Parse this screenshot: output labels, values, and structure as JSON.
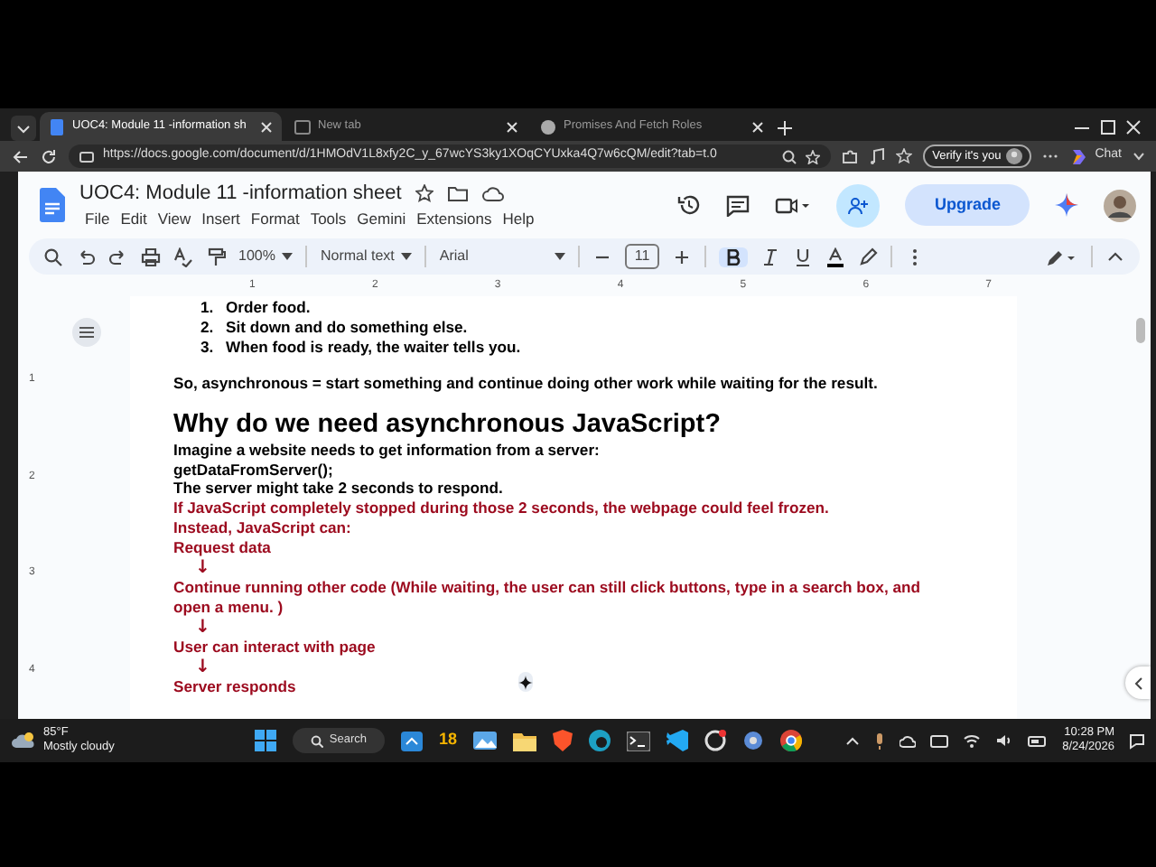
{
  "browser": {
    "tabs": [
      {
        "title": "UOC4: Module 11 -information sh",
        "selected": true
      },
      {
        "title": "New tab",
        "selected": false
      },
      {
        "title": "Promises And Fetch Roles",
        "selected": false
      }
    ],
    "url": "https://docs.google.com/document/d/1HMOdV1L8xfy2C_y_67wcYS3ky1XOqCYUxka4Q7w6cQM/edit?tab=t.0",
    "verify": "Verify it's you",
    "chat": "Chat"
  },
  "docs": {
    "title": "UOC4:  Module 11 -information sheet",
    "menu": [
      "File",
      "Edit",
      "View",
      "Insert",
      "Format",
      "Tools",
      "Gemini",
      "Extensions",
      "Help"
    ],
    "upgrade": "Upgrade",
    "toolbar": {
      "zoom": "100%",
      "style": "Normal text",
      "font": "Arial",
      "size": "11",
      "bold_on": true
    },
    "ruler": [
      "1",
      "2",
      "3",
      "4",
      "5",
      "6",
      "7"
    ],
    "vertical_ruler": [
      "1",
      "2",
      "3",
      "4"
    ]
  },
  "document": [
    {
      "kind": "numbered",
      "number": "1.",
      "text": "Order food.",
      "color": "#000000"
    },
    {
      "kind": "numbered",
      "number": "2.",
      "text": "Sit down and do something else.",
      "color": "#000000"
    },
    {
      "kind": "numbered",
      "number": "3.",
      "text": "When food is ready, the waiter tells you.",
      "color": "#000000"
    },
    {
      "kind": "paragraph",
      "text": "So, asynchronous = start something and continue doing other work while waiting for the result.",
      "color": "#000000"
    },
    {
      "kind": "heading",
      "text": "Why do we need asynchronous JavaScript?",
      "color": "#000000"
    },
    {
      "kind": "line",
      "text": "Imagine a website needs to get information from a server:",
      "color": "#000000"
    },
    {
      "kind": "line",
      "text": "getDataFromServer();",
      "color": "#000000"
    },
    {
      "kind": "line",
      "text": "The server might take 2 seconds to respond.",
      "color": "#000000"
    },
    {
      "kind": "line",
      "text": "If JavaScript completely stopped during those 2 seconds, the webpage could feel frozen.",
      "color": "#9c0a1e"
    },
    {
      "kind": "line",
      "text": "Instead, JavaScript can:",
      "color": "#9c0a1e"
    },
    {
      "kind": "line",
      "text": "Request data",
      "color": "#9c0a1e"
    },
    {
      "kind": "arrow",
      "text": "↓",
      "color": "#9c0a1e"
    },
    {
      "kind": "line",
      "text": "Continue running other code (While waiting, the user can still click buttons, type in a search box, and open a menu. )",
      "color": "#9c0a1e"
    },
    {
      "kind": "arrow",
      "text": "↓",
      "color": "#9c0a1e"
    },
    {
      "kind": "line",
      "text": "User can interact with page",
      "color": "#9c0a1e"
    },
    {
      "kind": "arrow",
      "text": "↓",
      "color": "#9c0a1e"
    },
    {
      "kind": "line",
      "text": "Server responds",
      "color": "#9c0a1e"
    }
  ],
  "taskbar": {
    "temperature": "85°F",
    "weather": "Mostly cloudy",
    "search": "Search",
    "app_badge": "18",
    "time": "10:28 PM",
    "date": "8/24/2026"
  }
}
